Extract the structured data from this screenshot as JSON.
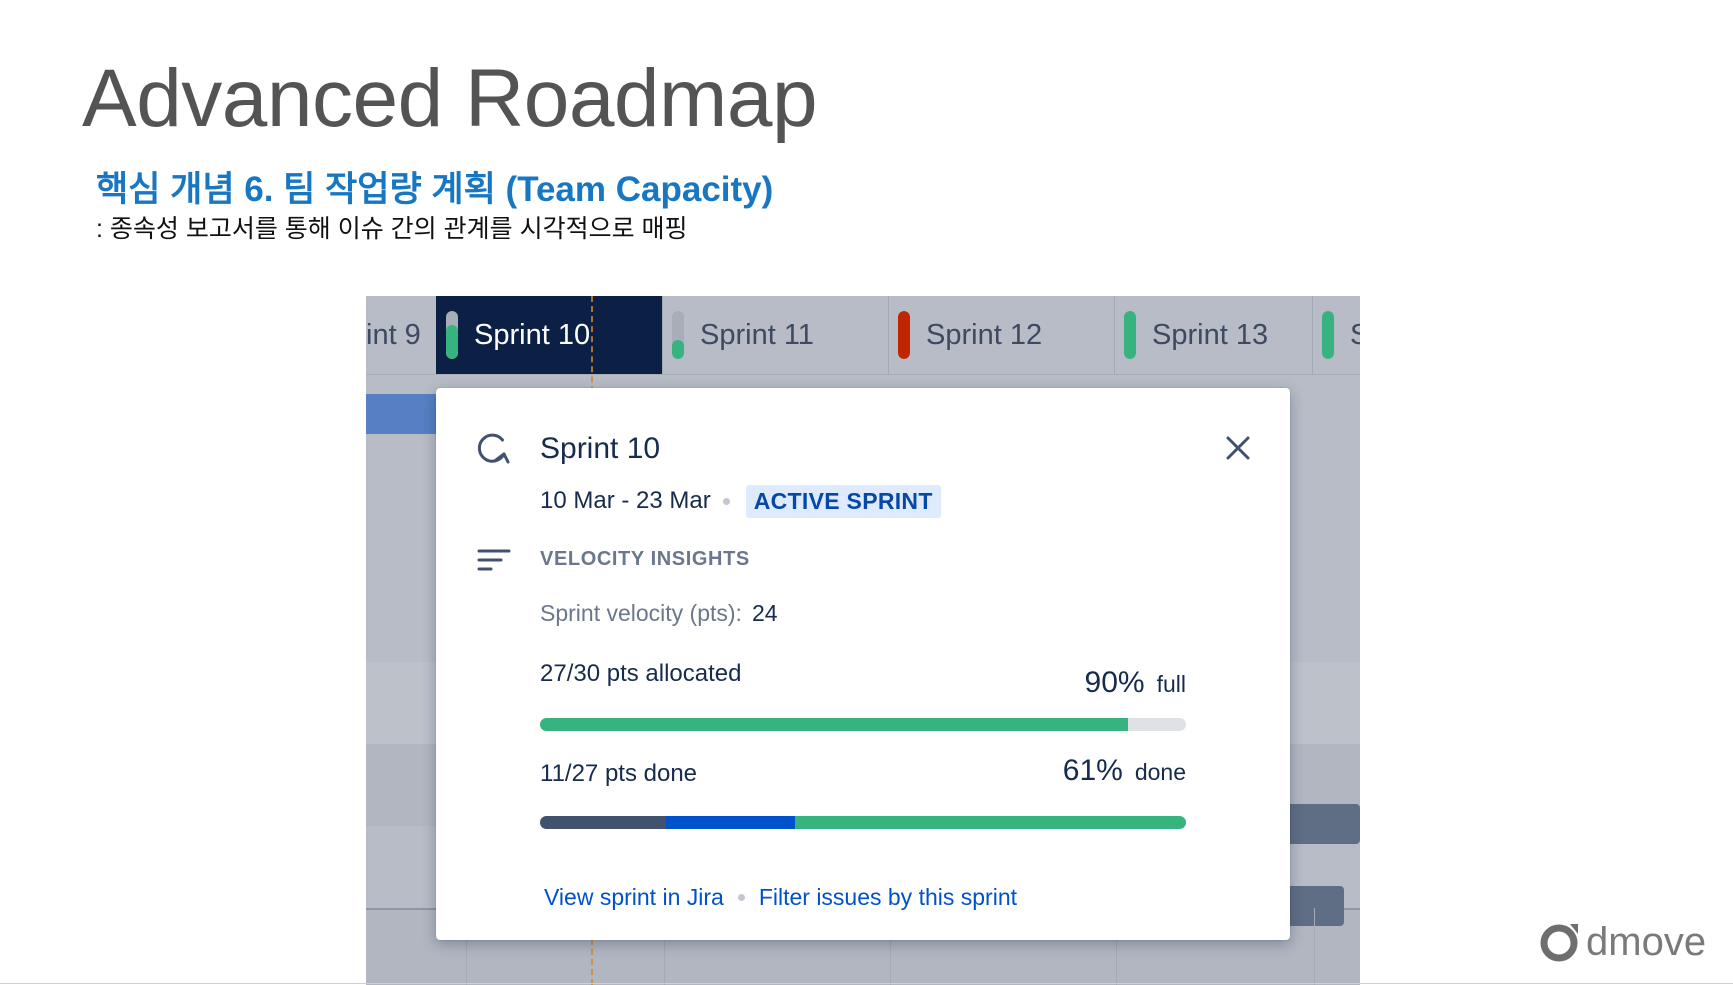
{
  "slide": {
    "title": "Advanced Roadmap",
    "subtitle": "핵심 개념 6. 팀 작업량 계획 (Team Capacity)",
    "description": ": 종속성 보고서를 통해 이슈 간의 관계를 시각적으로 매핑",
    "logo_text": "dmove"
  },
  "timeline": {
    "sprints": [
      {
        "label": "int 9",
        "status_color": "",
        "fill": 0
      },
      {
        "label": "Sprint 10",
        "status_color": "#36b37e",
        "fill": 0.7,
        "active": true
      },
      {
        "label": "Sprint 11",
        "status_color": "#36b37e",
        "fill": 0.4
      },
      {
        "label": "Sprint 12",
        "status_color": "#bf2600",
        "fill": 1.0
      },
      {
        "label": "Sprint 13",
        "status_color": "#36b37e",
        "fill": 1.0
      },
      {
        "label": "S",
        "status_color": "#36b37e",
        "fill": 1.0
      }
    ]
  },
  "card": {
    "title": "Sprint 10",
    "dates": "10 Mar - 23 Mar",
    "status": "ACTIVE SPRINT",
    "section_label": "VELOCITY INSIGHTS",
    "velocity_label": "Sprint velocity (pts):",
    "velocity_value": "24",
    "allocated": {
      "label": "27/30 pts allocated",
      "percent": "90%",
      "suffix": "full",
      "fill_fraction": 0.91,
      "color": "#36b37e"
    },
    "done": {
      "label": "11/27 pts done",
      "percent": "61%",
      "suffix": "done",
      "segments": [
        {
          "fraction": 0.195,
          "color": "#42526e"
        },
        {
          "fraction": 0.2,
          "color": "#0052cc"
        },
        {
          "fraction": 0.605,
          "color": "#36b37e"
        }
      ]
    },
    "links": {
      "view": "View sprint in Jira",
      "filter": "Filter issues by this sprint"
    }
  },
  "colors": {
    "title_gray": "#545454",
    "subtitle_blue": "#1877c2",
    "active_tab": "#0c1f44",
    "link_blue": "#0052cc",
    "badge_bg": "#deebff",
    "badge_text": "#0747a6"
  }
}
